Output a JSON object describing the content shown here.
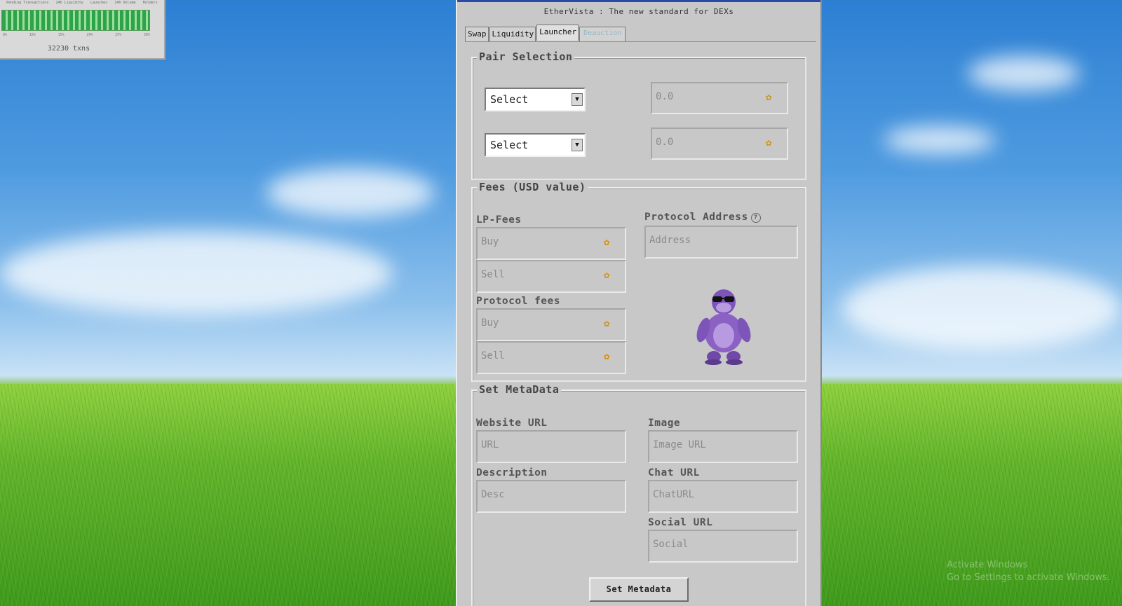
{
  "mini_window": {
    "column_labels": [
      "Pending Transactions",
      "24h Liquidity",
      "Launches",
      "24h Volume",
      "Holders"
    ],
    "tick_labels": [
      "0%",
      "10%",
      "15%",
      "20%",
      "25%",
      "30%"
    ],
    "txns": "32230 txns"
  },
  "window": {
    "title": "EtherVista : The new standard for DEXs",
    "tabs": [
      "Swap",
      "Liquidity",
      "Launcher",
      "Deauction"
    ],
    "active_tab": "Launcher"
  },
  "pair_selection": {
    "legend": "Pair Selection",
    "rows": [
      {
        "select": "Select",
        "amount": "0.0"
      },
      {
        "select": "Select",
        "amount": "0.0"
      }
    ]
  },
  "fees": {
    "legend": "Fees (USD value)",
    "lp_fees_label": "LP-Fees",
    "lp_buy": "Buy",
    "lp_sell": "Sell",
    "protocol_fees_label": "Protocol fees",
    "proto_buy": "Buy",
    "proto_sell": "Sell",
    "protocol_address_label": "Protocol Address",
    "protocol_address_placeholder": "Address"
  },
  "metadata": {
    "legend": "Set MetaData",
    "website_label": "Website URL",
    "website_placeholder": "URL",
    "image_label": "Image",
    "image_placeholder": "Image URL",
    "description_label": "Description",
    "description_placeholder": "Desc",
    "chat_label": "Chat URL",
    "chat_placeholder": "ChatURL",
    "social_label": "Social URL",
    "social_placeholder": "Social",
    "submit": "Set Metadata"
  },
  "desktop": {
    "watermark_line1": "Activate Windows",
    "watermark_line2": "Go to Settings to activate Windows."
  },
  "icons": {
    "coin": "coin-icon",
    "dropdown": "chevron-down-icon",
    "help": "question-circle-icon",
    "mascot": "purple-gorilla-mascot"
  },
  "colors": {
    "window_bg": "#c8c8c8",
    "coin": "#d4900f",
    "mascot": "#8b62c4"
  }
}
